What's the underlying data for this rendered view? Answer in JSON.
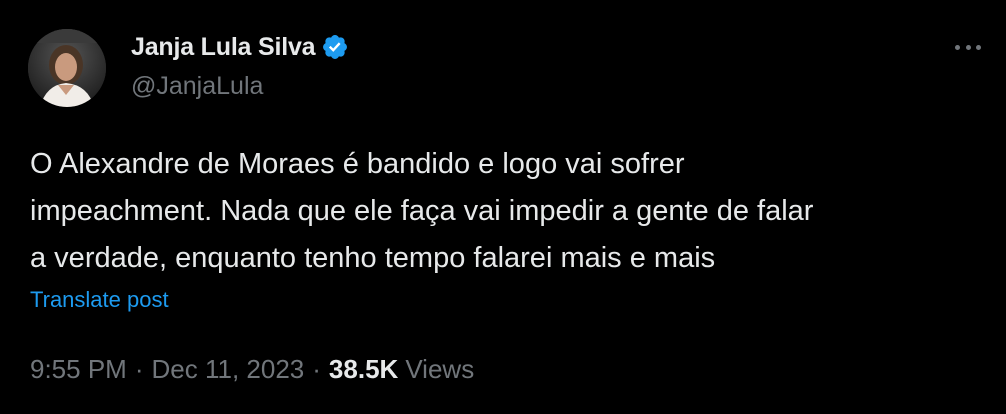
{
  "tweet": {
    "author": {
      "display_name": "Janja Lula Silva",
      "handle": "@JanjaLula",
      "verified_icon": "verified-badge-icon",
      "verified_color": "#1d9bf0"
    },
    "text_lines": [
      "O Alexandre de Moraes é bandido e logo vai sofrer",
      "impeachment. Nada que ele faça vai impedir a gente de falar",
      "a verdade, enquanto tenho tempo falarei mais e mais"
    ],
    "translate_label": "Translate post",
    "time": "9:55 PM",
    "separator": "·",
    "date": "Dec 11, 2023",
    "views_count": "38.5K",
    "views_label": "Views",
    "more_icon": "more-horizontal-icon"
  },
  "colors": {
    "background": "#000000",
    "primary_text": "#e7e9ea",
    "secondary_text": "#71767b",
    "link": "#1d9bf0"
  }
}
